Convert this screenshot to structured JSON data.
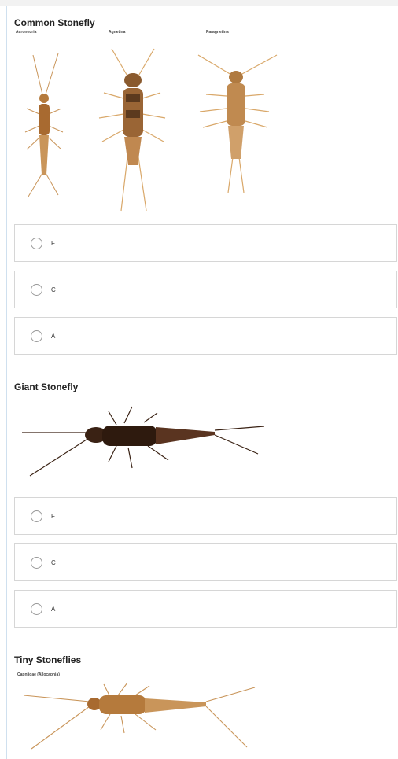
{
  "sections": [
    {
      "title": "Common Stonefly",
      "image_labels": [
        "Acroneuria",
        "Agnetina",
        "Paragnetina"
      ],
      "options": [
        "F",
        "C",
        "A"
      ]
    },
    {
      "title": "Giant Stonefly",
      "options": [
        "F",
        "C",
        "A"
      ]
    },
    {
      "title": "Tiny Stoneflies",
      "image_labels": [
        "Capniidae (Allocapnia)"
      ]
    }
  ],
  "colors": {
    "radio_border": "#999999",
    "option_border": "#d6d6d6",
    "insect_tan": "#c9955a",
    "insect_dark": "#3a2214",
    "insect_light": "#d9a86a"
  },
  "icons": [
    "radio-unselected-icon"
  ]
}
